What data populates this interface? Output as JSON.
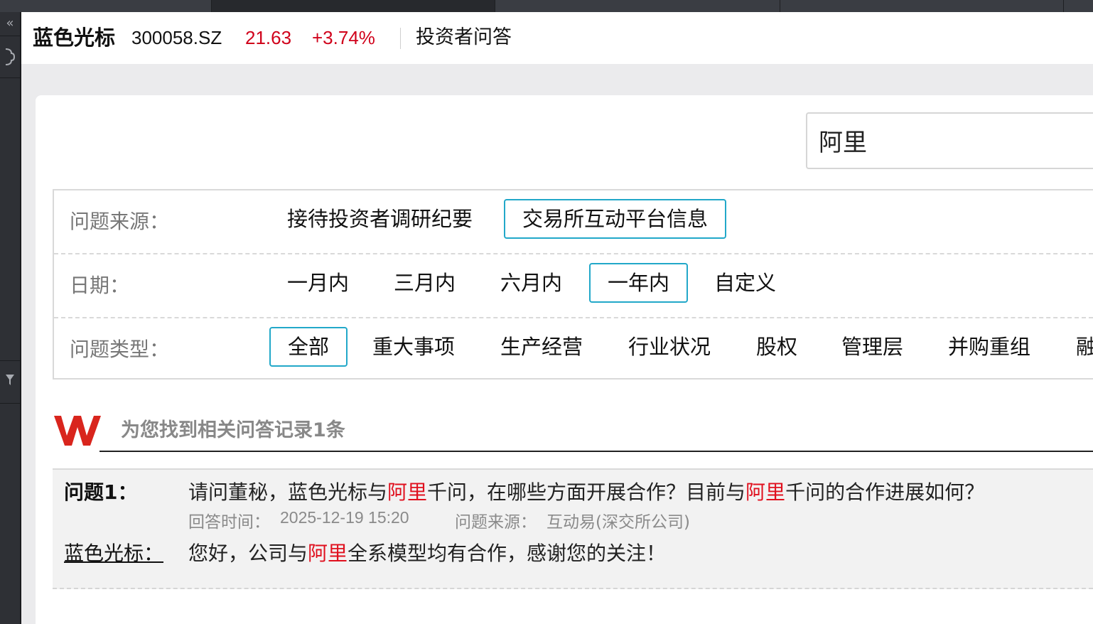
{
  "stock": {
    "name": "蓝色光标",
    "code": "300058.SZ",
    "price": "21.63",
    "change": "+3.74%"
  },
  "page_title": "投资者问答",
  "search": {
    "value": "阿里"
  },
  "filters": {
    "source": {
      "label": "问题来源：",
      "options": [
        "接待投资者调研纪要",
        "交易所互动平台信息"
      ],
      "selected": "交易所互动平台信息"
    },
    "date": {
      "label": "日期：",
      "options": [
        "一月内",
        "三月内",
        "六月内",
        "一年内",
        "自定义"
      ],
      "selected": "一年内"
    },
    "type": {
      "label": "问题类型：",
      "options": [
        "全部",
        "重大事项",
        "生产经营",
        "行业状况",
        "股权",
        "管理层",
        "并购重组",
        "融"
      ],
      "selected": "全部"
    }
  },
  "results": {
    "count_text": "为您找到相关问答记录1条",
    "items": [
      {
        "q_label": "问题1：",
        "q_parts": [
          "请问董秘，蓝色光标与",
          "阿里",
          "千问，在哪些方面开展合作？目前与",
          "阿里",
          "千问的合作进展如何？"
        ],
        "answer_time_label": "回答时间：",
        "answer_time": "2025-12-19 15:20",
        "source_label": "问题来源：",
        "source": "互动易(深交所公司)",
        "a_label": "蓝色光标：",
        "a_parts": [
          "您好，公司与",
          "阿里",
          "全系模型均有合作，感谢您的关注！"
        ]
      }
    ]
  },
  "colors": {
    "accent_border": "#22a8c9",
    "price_red": "#d0021b",
    "highlight_red": "#e0101e",
    "logo_red": "#d9251d"
  },
  "icons": {
    "rail": [
      "double-chevron-left-icon",
      "plugin-icon",
      "filter-icon"
    ]
  }
}
